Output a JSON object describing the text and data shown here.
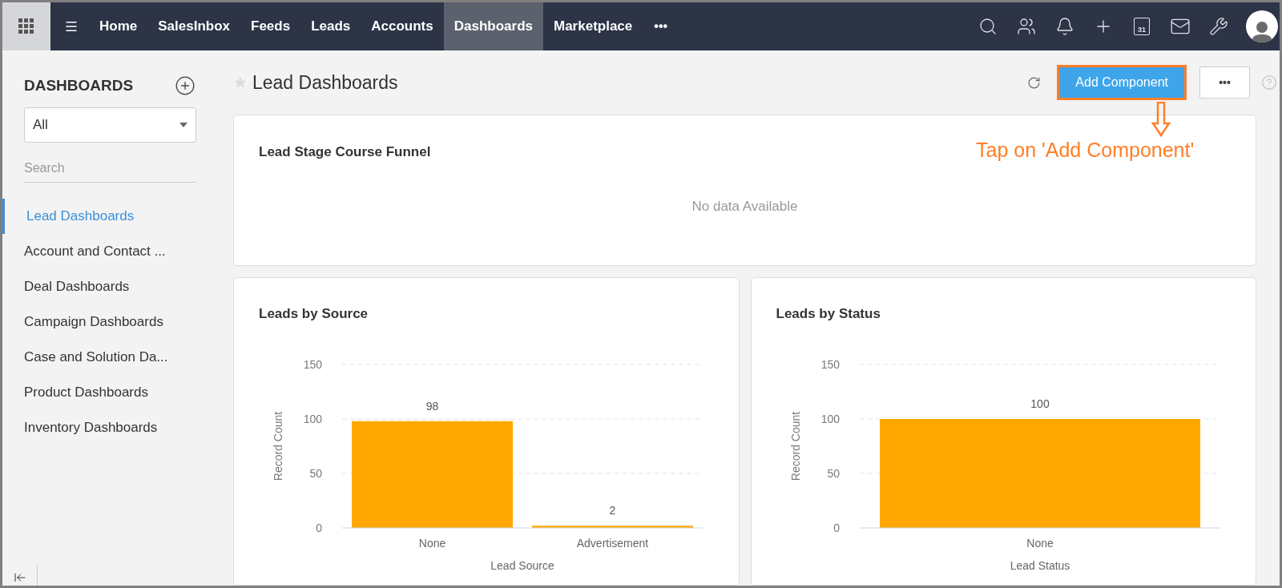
{
  "nav": {
    "items": [
      {
        "label": "Home",
        "selected": false
      },
      {
        "label": "SalesInbox",
        "selected": false
      },
      {
        "label": "Feeds",
        "selected": false
      },
      {
        "label": "Leads",
        "selected": false
      },
      {
        "label": "Accounts",
        "selected": false
      },
      {
        "label": "Dashboards",
        "selected": true
      },
      {
        "label": "Marketplace",
        "selected": false
      }
    ],
    "more": "•••",
    "calendar_day": "31"
  },
  "sidebar": {
    "title": "DASHBOARDS",
    "filter": {
      "value": "All"
    },
    "search": {
      "placeholder": "Search"
    },
    "items": [
      {
        "label": "Lead Dashboards",
        "selected": true
      },
      {
        "label": "Account and Contact ...",
        "selected": false
      },
      {
        "label": "Deal Dashboards",
        "selected": false
      },
      {
        "label": "Campaign Dashboards",
        "selected": false
      },
      {
        "label": "Case and Solution Da...",
        "selected": false
      },
      {
        "label": "Product Dashboards",
        "selected": false
      },
      {
        "label": "Inventory Dashboards",
        "selected": false
      }
    ]
  },
  "page": {
    "title": "Lead Dashboards",
    "favorite": false,
    "add_button": "Add Component",
    "more_button": "•••",
    "callout": "Tap on 'Add Component'"
  },
  "cards": [
    {
      "kind": "empty",
      "title": "Lead Stage Course Funnel",
      "message": "No data Available"
    },
    {
      "kind": "chart",
      "title": "Leads by Source",
      "chart_data": {
        "type": "bar",
        "xlabel": "Lead Source",
        "ylabel": "Record Count",
        "categories": [
          "None",
          "Advertisement"
        ],
        "values": [
          98,
          2
        ],
        "ylim": [
          0,
          150
        ],
        "yticks": [
          0,
          50,
          100,
          150
        ],
        "data_labels": true
      }
    },
    {
      "kind": "chart",
      "title": "Leads by Status",
      "chart_data": {
        "type": "bar",
        "xlabel": "Lead Status",
        "ylabel": "Record Count",
        "categories": [
          "None"
        ],
        "values": [
          100
        ],
        "ylim": [
          0,
          150
        ],
        "yticks": [
          0,
          50,
          100,
          150
        ],
        "data_labels": true
      }
    }
  ]
}
